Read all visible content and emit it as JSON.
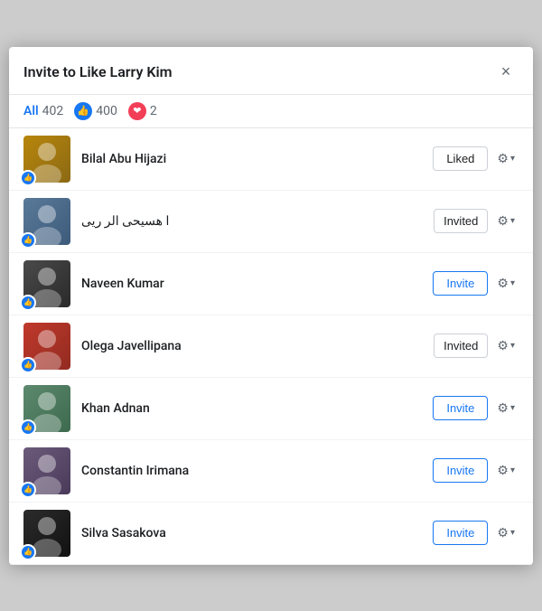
{
  "modal": {
    "title": "Invite to Like Larry Kim",
    "close_label": "×"
  },
  "filters": {
    "all_label": "All",
    "all_count": "402",
    "like_count": "400",
    "love_count": "2"
  },
  "people": [
    {
      "id": 1,
      "name": "Bilal Abu Hijazi",
      "avatar_class": "av1",
      "action": "liked",
      "action_label": "Liked"
    },
    {
      "id": 2,
      "name": "ا هسیحی الر ریی",
      "avatar_class": "av2",
      "action": "invited",
      "action_label": "Invited"
    },
    {
      "id": 3,
      "name": "Naveen Kumar",
      "avatar_class": "av3",
      "action": "invite",
      "action_label": "Invite"
    },
    {
      "id": 4,
      "name": "Olega Javellipana",
      "avatar_class": "av4",
      "action": "invited",
      "action_label": "Invited"
    },
    {
      "id": 5,
      "name": "Khan Adnan",
      "avatar_class": "av5",
      "action": "invite",
      "action_label": "Invite"
    },
    {
      "id": 6,
      "name": "Constantin Irimana",
      "avatar_class": "av6",
      "action": "invite",
      "action_label": "Invite"
    },
    {
      "id": 7,
      "name": "Silva Sasakova",
      "avatar_class": "av7",
      "action": "invite",
      "action_label": "Invite"
    }
  ]
}
